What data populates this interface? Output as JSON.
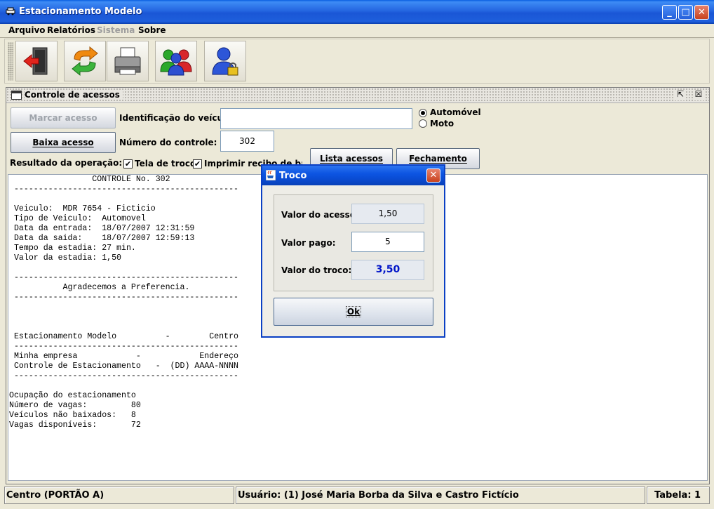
{
  "window": {
    "title": "Estacionamento Modelo",
    "minimize_glyph": "_",
    "maximize_glyph": "□",
    "close_glyph": "✕"
  },
  "menu": {
    "items": [
      {
        "label": "Arquivo",
        "enabled": true
      },
      {
        "label": "Relatórios",
        "enabled": true
      },
      {
        "label": "Sistema",
        "enabled": false
      },
      {
        "label": "Sobre",
        "enabled": true
      }
    ]
  },
  "toolbar": {
    "buttons": [
      {
        "icon": "exit-door-icon"
      },
      {
        "icon": "refresh-arrows-icon"
      },
      {
        "icon": "printer-icon"
      },
      {
        "icon": "users-group-icon"
      },
      {
        "icon": "user-lock-icon"
      }
    ]
  },
  "frame": {
    "title": "Controle de acessos",
    "restore_glyph": "⇱",
    "close_glyph": "☒"
  },
  "form": {
    "marcar_label": "Marcar acesso",
    "baixa_label": "Baixa acesso",
    "id_label": "Identificação do veículo:",
    "id_value": "",
    "controle_label": "Número do controle:",
    "controle_value": "302",
    "radio_auto": "Automóvel",
    "radio_moto": "Moto",
    "resultado_label": "Resultado da operação:",
    "tela_troco": "Tela de troco",
    "imprimir_recibo": "Imprimir recibo de baixa",
    "lista_label": "Lista acessos",
    "fechamento_label": "Fechamento"
  },
  "report": {
    "text": "                 CONTROLE No. 302\n ----------------------------------------------\n\n Veiculo:  MDR 7654 - Ficticio\n Tipo de Veiculo:  Automovel\n Data da entrada:  18/07/2007 12:31:59\n Data da saida:    18/07/2007 12:59:13\n Tempo da estadia: 27 min.\n Valor da estadia: 1,50\n\n ----------------------------------------------\n           Agradecemos a Preferencia.\n ----------------------------------------------\n\n\n\n Estacionamento Modelo          -        Centro\n ----------------------------------------------\n Minha empresa            -            Endereço\n Controle de Estacionamento   -  (DD) AAAA-NNNN\n ----------------------------------------------\n\nOcupação do estacionamento\nNúmero de vagas:         80\nVeículos não baixados:   8\nVagas disponíveis:       72"
  },
  "status": {
    "local": "Centro (PORTÃO A)",
    "usuario": "Usuário: (1) José Maria Borba da Silva e Castro Fictício",
    "tabela": "Tabela: 1"
  },
  "dialog": {
    "title": "Troco",
    "close_glyph": "✕",
    "valor_acesso_label": "Valor do acesso:",
    "valor_acesso": "1,50",
    "valor_pago_label": "Valor pago:",
    "valor_pago": "5",
    "valor_troco_label": "Valor do troco:",
    "valor_troco": "3,50",
    "ok_label": "Ok"
  },
  "colors": {
    "xp_blue": "#0A4ED8",
    "troco_value": "#0014C8",
    "close_red": "#C8421E"
  }
}
